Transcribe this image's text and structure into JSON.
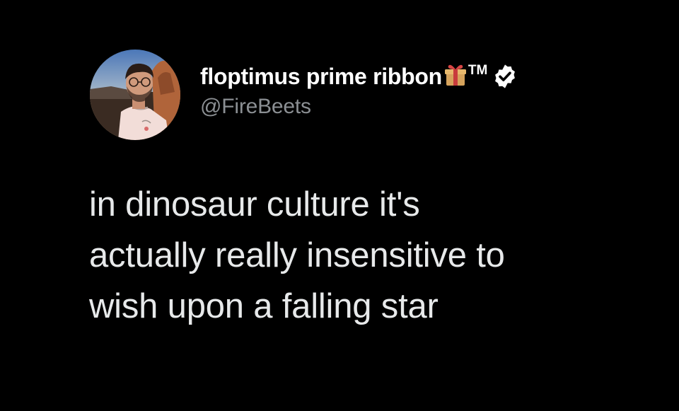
{
  "tweet": {
    "author": {
      "display_name": "floptimus prime ribbon",
      "badge_suffix": "TM",
      "handle": "@FireBeets",
      "verified": true
    },
    "text_lines": [
      "in dinosaur culture it's",
      "actually really insensitive to",
      "wish upon a falling star"
    ]
  },
  "icons": {
    "gift": "wrapped-gift-icon",
    "verified": "verified-badge-icon"
  },
  "colors": {
    "background": "#000000",
    "name": "#ffffff",
    "handle": "#8b8f93",
    "body_text": "#e7e9ea"
  }
}
